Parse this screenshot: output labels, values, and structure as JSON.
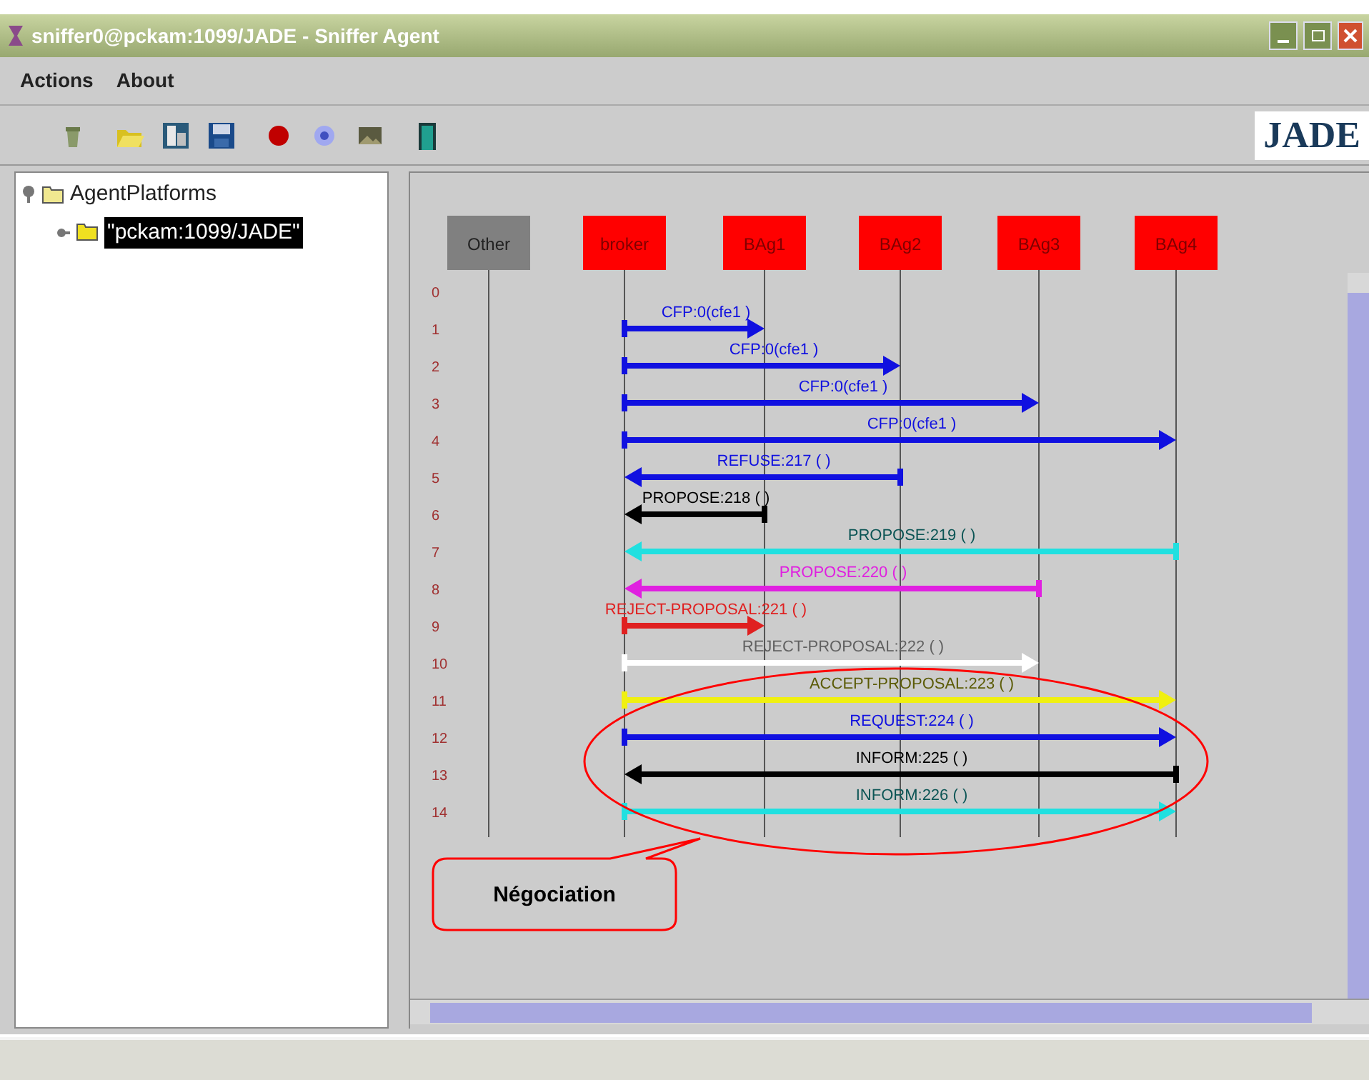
{
  "window": {
    "title": "sniffer0@pckam:1099/JADE - Sniffer Agent"
  },
  "menu": [
    "Actions",
    "About"
  ],
  "toolbar": [
    {
      "kind": "clear"
    },
    {
      "kind": "open"
    },
    {
      "kind": "save-as"
    },
    {
      "kind": "save"
    },
    {
      "kind": "record"
    },
    {
      "kind": "sniff"
    },
    {
      "kind": "image"
    },
    {
      "kind": "exit"
    }
  ],
  "logo": "JADE",
  "tree": {
    "label": "AgentPlatforms",
    "expanded": true,
    "children": [
      {
        "label": "\"pckam:1099/JADE\"",
        "selected": true,
        "expanded": false
      }
    ]
  },
  "diagram": {
    "agents": [
      {
        "name": "Other",
        "kind": "other"
      },
      {
        "name": "broker",
        "kind": "agent"
      },
      {
        "name": "BAg1",
        "kind": "agent"
      },
      {
        "name": "BAg2",
        "kind": "agent"
      },
      {
        "name": "BAg3",
        "kind": "agent"
      },
      {
        "name": "BAg4",
        "kind": "agent"
      }
    ],
    "rows": [
      "0",
      "1",
      "2",
      "3",
      "4",
      "5",
      "6",
      "7",
      "8",
      "9",
      "10",
      "11",
      "12",
      "13",
      "14"
    ],
    "messages": [
      {
        "label": "CFP:0(cfe1 )",
        "color": "#1010e0"
      },
      {
        "label": "CFP:0(cfe1 )",
        "color": "#1010e0"
      },
      {
        "label": "CFP:0(cfe1 )",
        "color": "#1010e0"
      },
      {
        "label": "CFP:0(cfe1 )",
        "color": "#1010e0"
      },
      {
        "label": "REFUSE:217 ( )",
        "color": "#1010e0"
      },
      {
        "label": "PROPOSE:218 ( )",
        "color": "#000000"
      },
      {
        "label": "PROPOSE:219 ( )",
        "color": "#20e0e0"
      },
      {
        "label": "PROPOSE:220 ( )",
        "color": "#e020e0"
      },
      {
        "label": "REJECT-PROPOSAL:221 ( )",
        "color": "#e02020"
      },
      {
        "label": "REJECT-PROPOSAL:222 ( )",
        "color": "#ffffff"
      },
      {
        "label": "ACCEPT-PROPOSAL:223 ( )",
        "color": "#f0f010"
      },
      {
        "label": "REQUEST:224 ( )",
        "color": "#1010e0"
      },
      {
        "label": "INFORM:225 ( )",
        "color": "#000000"
      },
      {
        "label": "INFORM:226 ( )",
        "color": "#20e0e0"
      }
    ],
    "annotation": {
      "label": "Négociation"
    }
  }
}
